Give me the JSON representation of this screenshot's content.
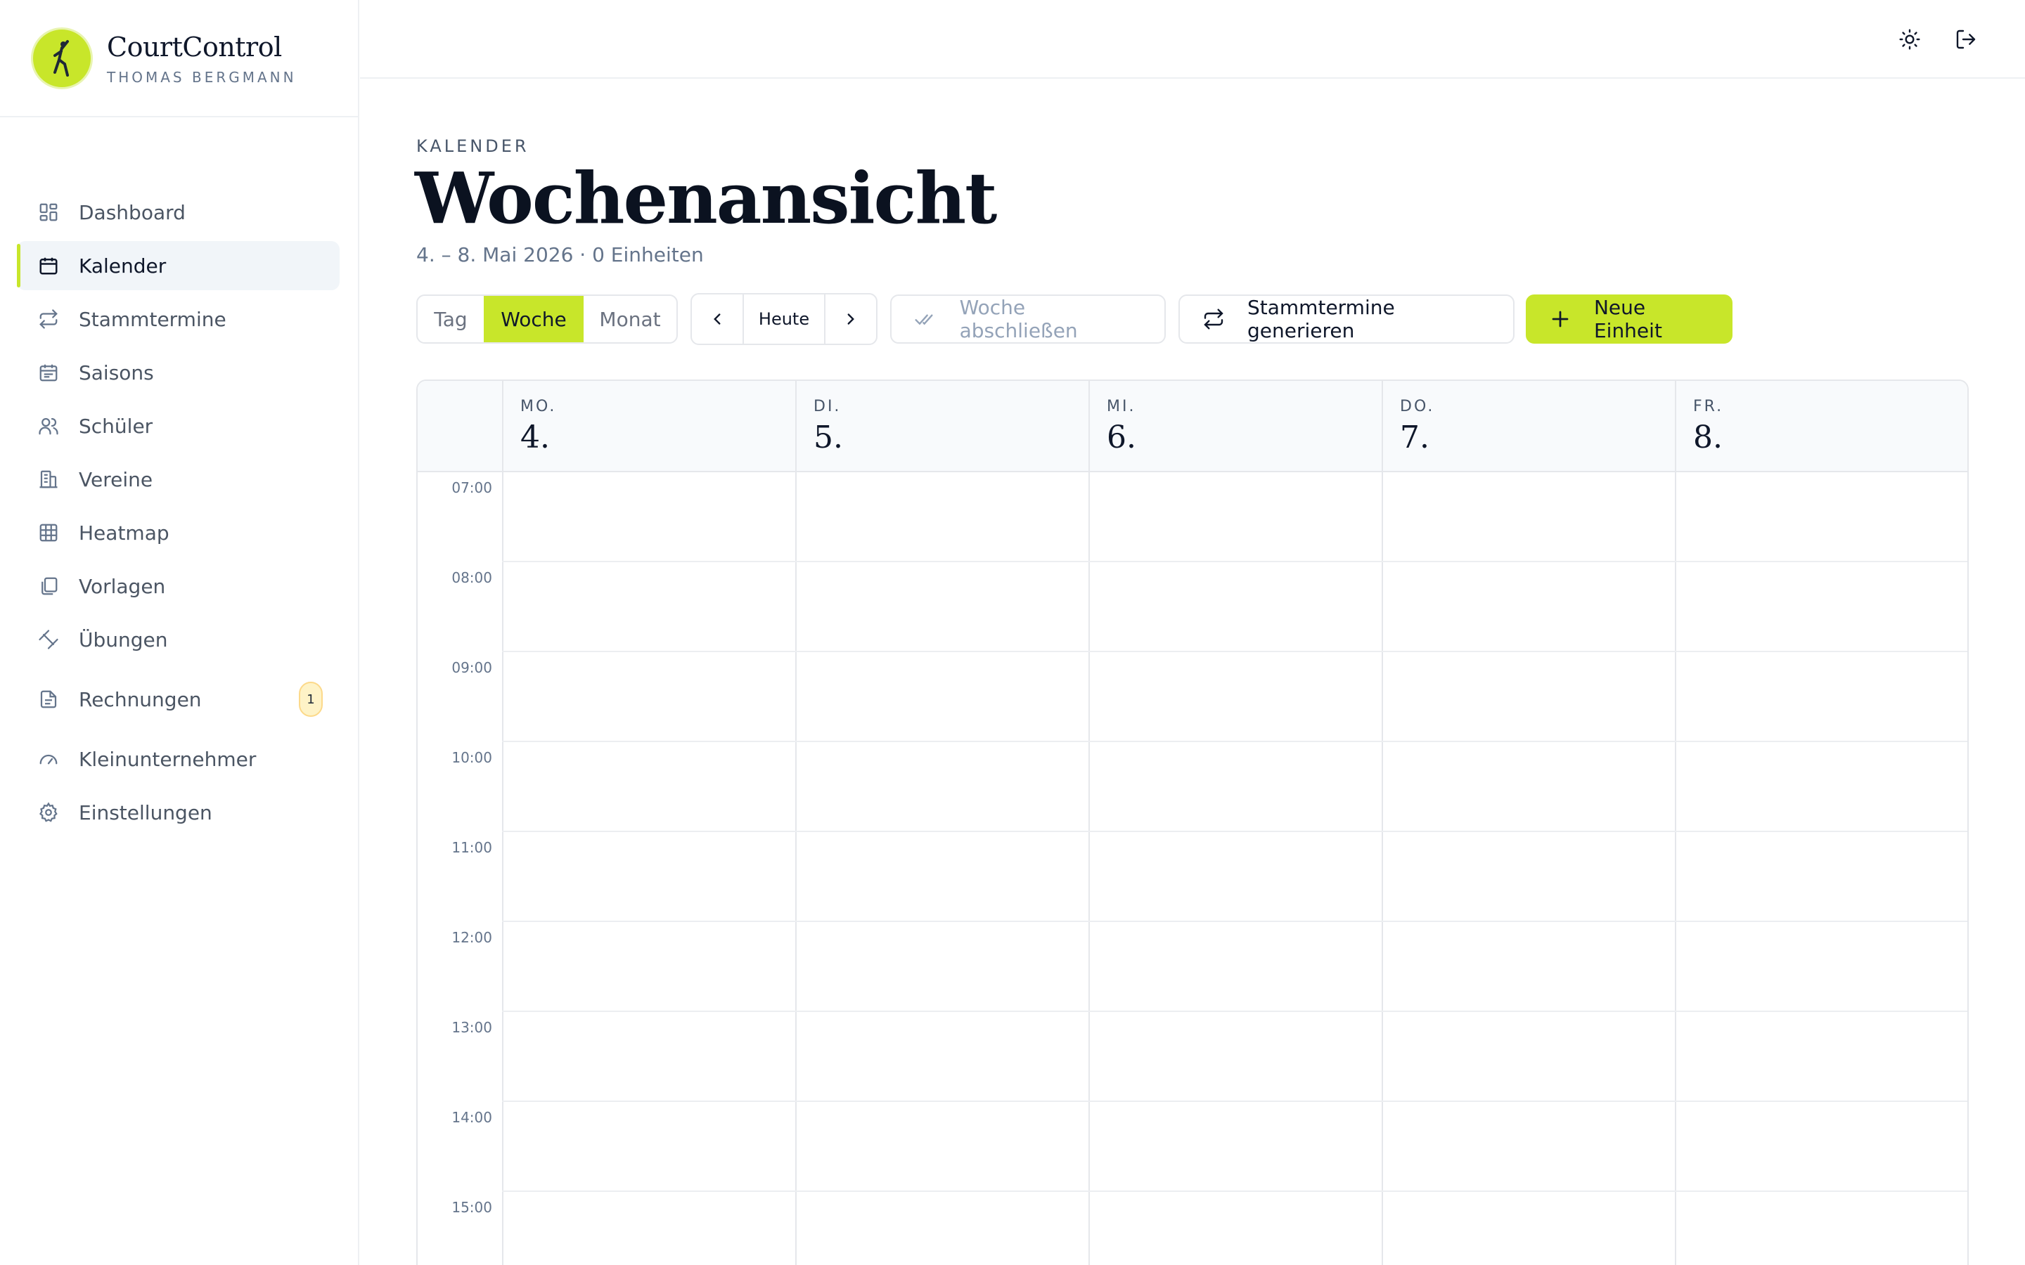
{
  "app": {
    "name": "CourtControl",
    "user": "THOMAS BERGMANN"
  },
  "sidebar": {
    "items": [
      {
        "label": "Dashboard",
        "icon": "dashboard-icon"
      },
      {
        "label": "Kalender",
        "icon": "calendar-icon",
        "active": true
      },
      {
        "label": "Stammtermine",
        "icon": "repeat-icon"
      },
      {
        "label": "Saisons",
        "icon": "calendar-list-icon"
      },
      {
        "label": "Schüler",
        "icon": "users-icon"
      },
      {
        "label": "Vereine",
        "icon": "building-icon"
      },
      {
        "label": "Heatmap",
        "icon": "grid-icon"
      },
      {
        "label": "Vorlagen",
        "icon": "copy-icon"
      },
      {
        "label": "Übungen",
        "icon": "dumbbell-icon"
      },
      {
        "label": "Rechnungen",
        "icon": "document-icon",
        "badge": "1"
      },
      {
        "label": "Kleinunternehmer",
        "icon": "gauge-icon"
      },
      {
        "label": "Einstellungen",
        "icon": "gear-icon"
      }
    ]
  },
  "topbar": {
    "theme_icon": "sun-icon",
    "logout_icon": "logout-icon"
  },
  "page": {
    "eyebrow": "KALENDER",
    "title": "Wochenansicht",
    "subtitle": "4. – 8. Mai 2026 · 0 Einheiten"
  },
  "toolbar": {
    "view_options": [
      "Tag",
      "Woche",
      "Monat"
    ],
    "selected_view": "Woche",
    "today_label": "Heute",
    "close_week_label": "Woche abschließen",
    "generate_label": "Stammtermine generieren",
    "new_label": "Neue Einheit"
  },
  "calendar": {
    "days": [
      {
        "name": "MO.",
        "num": "4."
      },
      {
        "name": "DI.",
        "num": "5."
      },
      {
        "name": "MI.",
        "num": "6."
      },
      {
        "name": "DO.",
        "num": "7."
      },
      {
        "name": "FR.",
        "num": "8."
      }
    ],
    "hours": [
      "07:00",
      "08:00",
      "09:00",
      "10:00",
      "11:00",
      "12:00",
      "13:00",
      "14:00",
      "15:00"
    ]
  },
  "colors": {
    "accent": "#c8e62a",
    "active_bg": "#f1f5f9",
    "border": "#e5e7eb",
    "badge_bg": "#fef3c7"
  }
}
